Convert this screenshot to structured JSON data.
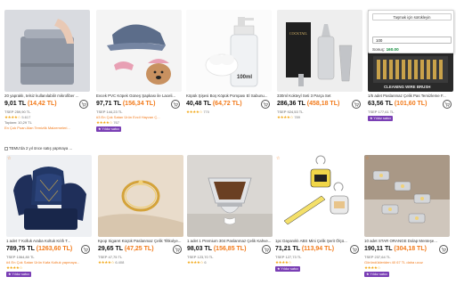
{
  "products": [
    {
      "title": "20 yapraklı, telsiz kullanılabilir mikrofiber ...",
      "price_try": "9,01 TL",
      "price_usd": "(14,42 TL)",
      "orig_price": "TSEP 259,90 TL",
      "stars": "★★★★☆",
      "rating_count": "5.617",
      "line1": "Toplam: 10,29 TL",
      "line2": "En Çok Puan Alan Temizlik Malzemeleri...",
      "badge": ""
    },
    {
      "title": "Evcek PVC Köpek Güneş Şapkası ile Laceli...",
      "price_try": "97,71 TL",
      "price_usd": "(156,34 TL)",
      "orig_price": "TSEP 144,23 TL",
      "stars": "★★★★☆",
      "rating_count": "767",
      "line1": "#3 En Çok Satan Ürün Evcil Hayvan Ç...",
      "line2": "",
      "badge": "Yıldız satıcı"
    },
    {
      "title": "Köpük Şişesi Boş Köpük Pompası El Sabunu...",
      "price_try": "40,48 TL",
      "price_usd": "(64,72 TL)",
      "orig_price": "",
      "stars": "★★★★☆",
      "rating_count": "770",
      "line1": "",
      "line2": "",
      "badge": ""
    },
    {
      "title": "330ml Kokteyl Seti 3 Parça Set",
      "price_try": "286,36 TL",
      "price_usd": "(458,18 TL)",
      "orig_price": "TSEP 924,53 TL",
      "stars": "★★★★☆",
      "rating_count": "789",
      "line1": "",
      "line2": "",
      "badge": ""
    },
    {
      "title": "1/5 adet Paslanmaz Çelik Pas Temizleme F...",
      "price_try": "63,56 TL",
      "price_usd": "(101,60 TL)",
      "orig_price": "TSEP 177,61 TL",
      "stars": "",
      "rating_count": "",
      "line1": "",
      "line2": "",
      "badge": "Yıldız satıcı"
    },
    {
      "title": "1 adet 7 Kolluk Araba Koltuk Kılıfı T...",
      "price_try": "789,75 TL",
      "price_usd": "(1263,60 TL)",
      "orig_price": "TSEP 1064,80 TL",
      "stars": "★★★★☆",
      "rating_count": "",
      "line1": "#4 En Çok Satan Ürün Kafa Koltuk yapmaya...",
      "line2": "",
      "badge": "Yıldız satıcı"
    },
    {
      "title": "Kpop Sigaret Küçük Paslanmaz Çelik Tiltkolye...",
      "price_try": "29,65 TL",
      "price_usd": "(47,25 TL)",
      "orig_price": "TSEP 47,75 TL",
      "stars": "★★★★☆",
      "rating_count": "6.408",
      "line1": "",
      "line2": "",
      "badge": ""
    },
    {
      "title": "1 adet 1 Premium 304 Paslanmaz Çelik Kahve...",
      "price_try": "98,03 TL",
      "price_usd": "(156,85 TL)",
      "orig_price": "TSEP 123,70 TL",
      "stars": "★★★★☆",
      "rating_count": "6",
      "line1": "",
      "line2": "",
      "badge": ""
    },
    {
      "title": "1pc Dayanıklı ABS Mini Çelik Şerit Ölçü...",
      "price_try": "71,21 TL",
      "price_usd": "(113,94 TL)",
      "orig_price": "TSEP 127,73 TL",
      "stars": "★★★★☆",
      "rating_count": "",
      "line1": "",
      "line2": "",
      "badge": "Yıldız satıcı"
    },
    {
      "title": "10 adet STAR ORANGE Dolap Menteşe...",
      "price_try": "190,11 TL",
      "price_usd": "(304,18 TL)",
      "orig_price": "TSEP 237,64 TL",
      "stars": "★★★★☆",
      "rating_count": "",
      "line1": "Göründükleriden 40 67 TL daha ucuz",
      "line2": "",
      "badge": "Yıldız satıcı"
    }
  ],
  "temu_note": "TEMU'da 2 yıl önce satış yapmaya ...",
  "popup": {
    "header": "Taşmak için sürükleyin",
    "input_value": "100",
    "result_label": "Sonuç:",
    "result_value": "160.00"
  },
  "colors": {
    "accent": "#f27a1a",
    "badge": "#7a3fb5",
    "star": "#f2a818"
  }
}
